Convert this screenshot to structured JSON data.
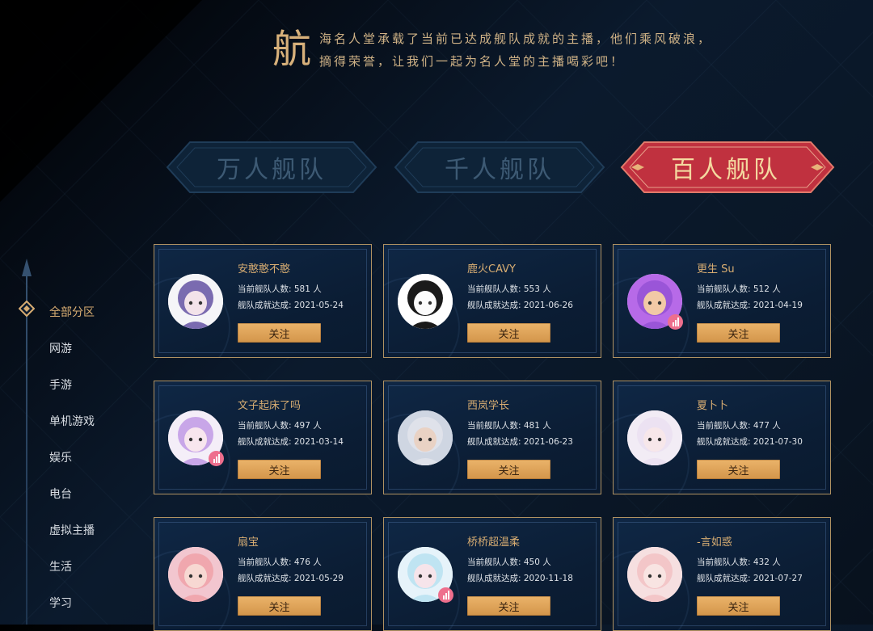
{
  "intro": {
    "big_char": "航",
    "line1": "海名人堂承载了当前已达成舰队成就的主播，他们乘风破浪，",
    "line2": "摘得荣誉，让我们一起为名人堂的主播喝彩吧！"
  },
  "tabs": [
    {
      "label": "万人舰队",
      "active": false
    },
    {
      "label": "千人舰队",
      "active": false
    },
    {
      "label": "百人舰队",
      "active": true
    }
  ],
  "sidebar": {
    "items": [
      {
        "label": "全部分区",
        "active": true
      },
      {
        "label": "网游",
        "active": false
      },
      {
        "label": "手游",
        "active": false
      },
      {
        "label": "单机游戏",
        "active": false
      },
      {
        "label": "娱乐",
        "active": false
      },
      {
        "label": "电台",
        "active": false
      },
      {
        "label": "虚拟主播",
        "active": false
      },
      {
        "label": "生活",
        "active": false
      },
      {
        "label": "学习",
        "active": false
      }
    ]
  },
  "card_labels": {
    "count_prefix": "当前舰队人数: ",
    "count_suffix": " 人",
    "date_prefix": "舰队成就达成: ",
    "follow": "关注"
  },
  "streamers": [
    {
      "name": "安憨憨不憨",
      "count": "581",
      "date": "2021-05-24",
      "live": false,
      "hair": "#7a6bb0",
      "skin": "#f3e3ea",
      "bg": "#f5f5f8"
    },
    {
      "name": "鹿火CAVY",
      "count": "553",
      "date": "2021-06-26",
      "live": false,
      "hair": "#1a1a1a",
      "skin": "#fbfbfb",
      "bg": "#ffffff"
    },
    {
      "name": "更生 Su",
      "count": "512",
      "date": "2021-04-19",
      "live": true,
      "hair": "#9a55d8",
      "skin": "#f2c9a6",
      "bg": "#b76ae8"
    },
    {
      "name": "文子起床了吗",
      "count": "497",
      "date": "2021-03-14",
      "live": true,
      "hair": "#c8a6e8",
      "skin": "#f8e6ee",
      "bg": "#f4eef8"
    },
    {
      "name": "西岚学长",
      "count": "481",
      "date": "2021-06-23",
      "live": false,
      "hair": "#dfe2ea",
      "skin": "#e9d2c4",
      "bg": "#cfd6e2"
    },
    {
      "name": "夏卜卜",
      "count": "477",
      "date": "2021-07-30",
      "live": false,
      "hair": "#ece2f2",
      "skin": "#f7e7ea",
      "bg": "#f2ecf5"
    },
    {
      "name": "扇宝",
      "count": "476",
      "date": "2021-05-29",
      "live": false,
      "hair": "#f0a7ae",
      "skin": "#f7d8d2",
      "bg": "#f2c6cf"
    },
    {
      "name": "桥桥超温柔",
      "count": "450",
      "date": "2020-11-18",
      "live": true,
      "hair": "#bfe4f2",
      "skin": "#f6e4ea",
      "bg": "#e6f3fa"
    },
    {
      "name": "-言如惑",
      "count": "432",
      "date": "2021-07-27",
      "live": false,
      "hair": "#f3c6c8",
      "skin": "#f8e4e2",
      "bg": "#f6dfe0"
    }
  ],
  "colors": {
    "accent_gold": "#d8ad72",
    "active_tab": "#c0313f",
    "button": "#e0a55c",
    "card_border": "#b09262",
    "live_badge": "#ee6f8d"
  }
}
